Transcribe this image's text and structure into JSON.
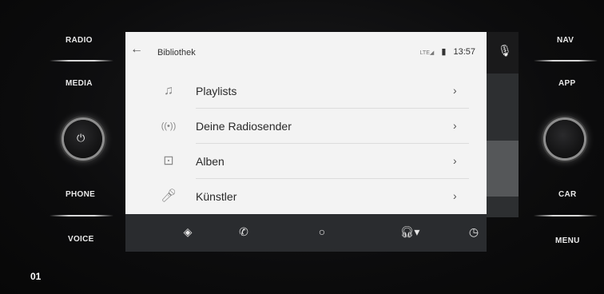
{
  "hardware": {
    "left_buttons": [
      "RADIO",
      "MEDIA",
      "PHONE",
      "VOICE"
    ],
    "right_buttons": [
      "NAV",
      "APP",
      "CAR",
      "MENU"
    ],
    "figure_number": "01"
  },
  "status_bar": {
    "title": "Bibliothek",
    "network": "LTE",
    "time": "13:57"
  },
  "library_items": [
    {
      "label": "Playlists",
      "icon": "playlist-icon"
    },
    {
      "label": "Deine Radiosender",
      "icon": "radio-station-icon"
    },
    {
      "label": "Alben",
      "icon": "album-icon"
    },
    {
      "label": "Künstler",
      "icon": "artist-icon"
    }
  ],
  "nav_bar": [
    "navigation-icon",
    "phone-icon",
    "home-icon",
    "headphones-icon",
    "recents-icon"
  ]
}
